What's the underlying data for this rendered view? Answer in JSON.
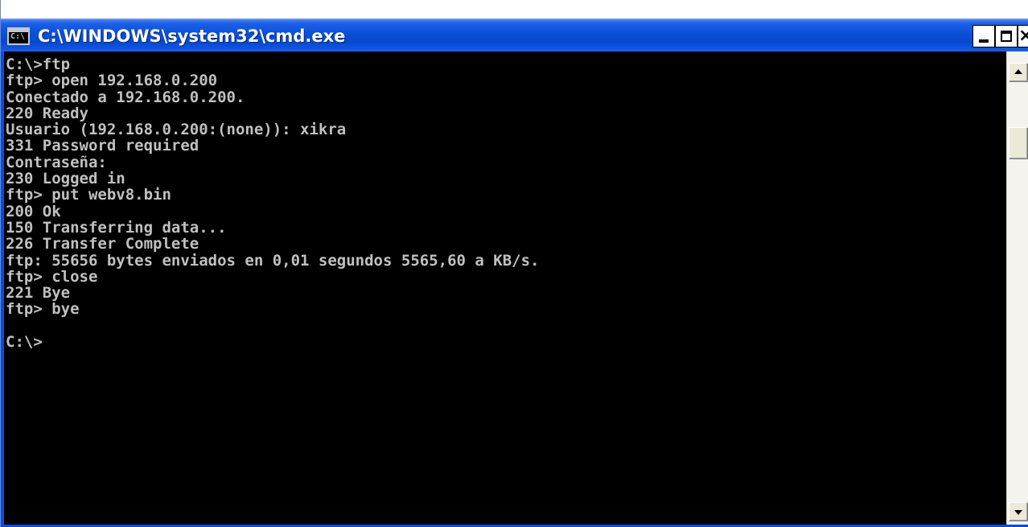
{
  "window": {
    "title": "C:\\WINDOWS\\system32\\cmd.exe",
    "icon": "cmd-icon",
    "icon_text": "C:\\",
    "buttons": {
      "minimize": "minimize-icon",
      "maximize": "maximize-icon",
      "close_symbol": "×"
    }
  },
  "console": {
    "background": "#000000",
    "foreground": "#c0c0c0",
    "lines": [
      "C:\\>ftp",
      "ftp> open 192.168.0.200",
      "Conectado a 192.168.0.200.",
      "220 Ready",
      "Usuario (192.168.0.200:(none)): xikra",
      "331 Password required",
      "Contraseña:",
      "230 Logged in",
      "ftp> put webv8.bin",
      "200 Ok",
      "150 Transferring data...",
      "226 Transfer Complete",
      "ftp: 55656 bytes enviados en 0,01 segundos 5565,60 a KB/s.",
      "ftp> close",
      "221 Bye",
      "ftp> bye",
      "",
      "C:\\>"
    ]
  },
  "scrollbar": {
    "up_icon": "arrow-up-icon",
    "down_icon": "arrow-down-icon"
  },
  "colors": {
    "titlebar": "#0a4ed8",
    "title_text": "#ffffff"
  }
}
